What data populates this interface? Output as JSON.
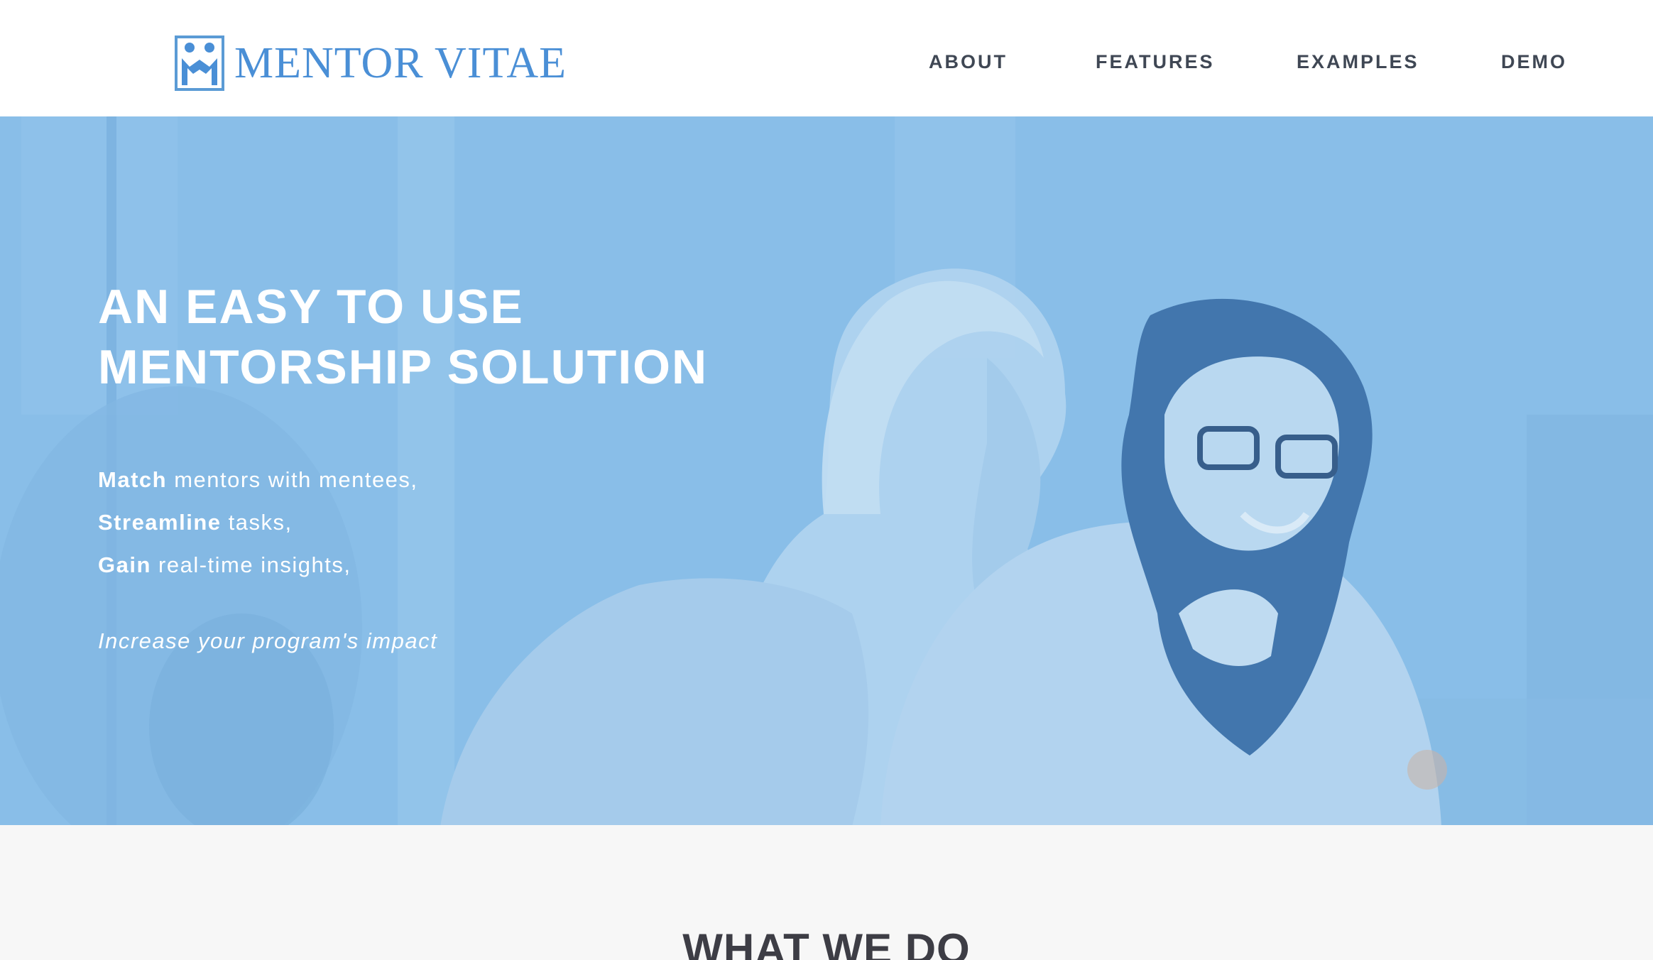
{
  "header": {
    "brand": "MENTOR VITAE",
    "nav": [
      "ABOUT",
      "FEATURES",
      "EXAMPLES",
      "DEMO"
    ]
  },
  "hero": {
    "title_line1": "AN EASY TO USE",
    "title_line2": "MENTORSHIP SOLUTION",
    "features": [
      {
        "bold": "Match",
        "rest": " mentors with mentees,"
      },
      {
        "bold": "Streamline",
        "rest": " tasks,"
      },
      {
        "bold": "Gain",
        "rest": " real-time insights,"
      }
    ],
    "tagline": "Increase your program's impact"
  },
  "section": {
    "title": "WHAT WE DO"
  },
  "colors": {
    "brand": "#4a8fd6",
    "nav_text": "#3f4754",
    "hero_tint": "#8ec0e8"
  }
}
